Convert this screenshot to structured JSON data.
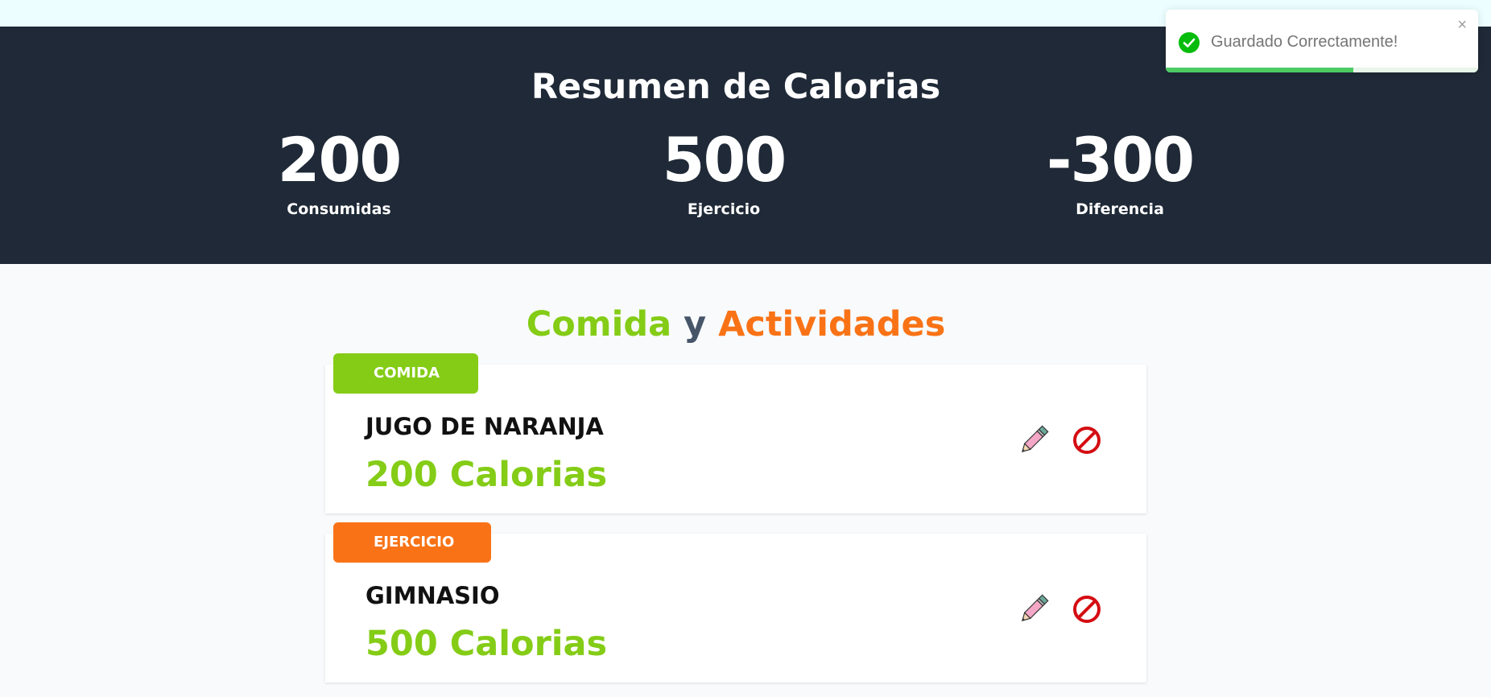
{
  "summary": {
    "title": "Resumen de Calorias",
    "stats": [
      {
        "value": "200",
        "label": "Consumidas"
      },
      {
        "value": "500",
        "label": "Ejercicio"
      },
      {
        "value": "-300",
        "label": "Diferencia"
      }
    ]
  },
  "section": {
    "title_part1": "Comida",
    "title_part2": "y",
    "title_part3": "Actividades"
  },
  "activities": [
    {
      "category": "Comida",
      "name": "Jugo de Naranja",
      "calories": "200 Calorias",
      "badge_color": "#84cc16"
    },
    {
      "category": "Ejercicio",
      "name": "Gimnasio",
      "calories": "500 Calorias",
      "badge_color": "#f97316"
    }
  ],
  "icons": {
    "edit": "pencil-icon",
    "delete": "no-entry-icon",
    "toast_status": "check-circle-icon",
    "toast_close": "close-icon"
  },
  "toast": {
    "message": "Guardado Correctamente!",
    "close_glyph": "×",
    "progress": 0.6
  },
  "colors": {
    "header_bg": "#1f2937",
    "food": "#84cc16",
    "exercise": "#f97316",
    "success": "#07bc0c"
  }
}
